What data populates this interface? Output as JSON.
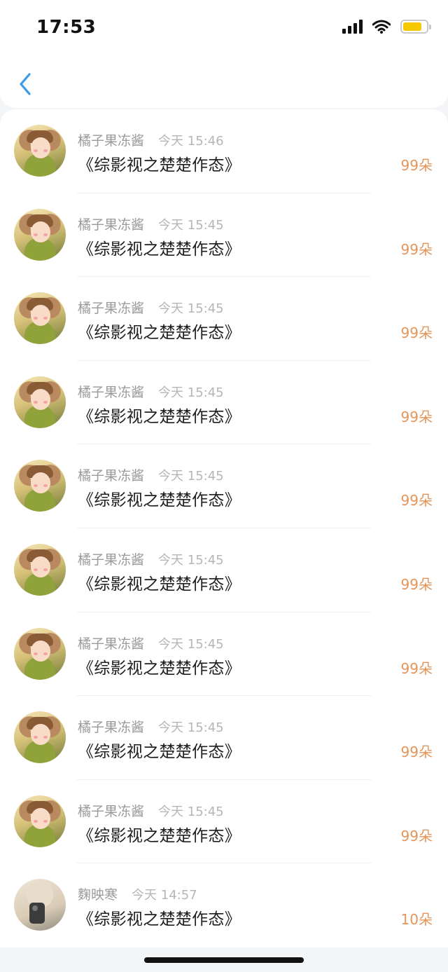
{
  "status_bar": {
    "time": "17:53",
    "signal_icon": "cellular-signal-icon",
    "wifi_icon": "wifi-icon",
    "battery_icon": "battery-icon",
    "battery_color": "#f5c800",
    "battery_level": 0.82
  },
  "nav": {
    "back_icon": "chevron-left-icon",
    "accent_color": "#3a9be8"
  },
  "records": [
    {
      "name": "橘子果冻酱",
      "time": "今天 15:46",
      "title": "《综影视之楚楚作态》",
      "amount": "99朵",
      "avatar": "girl-avatar"
    },
    {
      "name": "橘子果冻酱",
      "time": "今天 15:45",
      "title": "《综影视之楚楚作态》",
      "amount": "99朵",
      "avatar": "girl-avatar"
    },
    {
      "name": "橘子果冻酱",
      "time": "今天 15:45",
      "title": "《综影视之楚楚作态》",
      "amount": "99朵",
      "avatar": "girl-avatar"
    },
    {
      "name": "橘子果冻酱",
      "time": "今天 15:45",
      "title": "《综影视之楚楚作态》",
      "amount": "99朵",
      "avatar": "girl-avatar"
    },
    {
      "name": "橘子果冻酱",
      "time": "今天 15:45",
      "title": "《综影视之楚楚作态》",
      "amount": "99朵",
      "avatar": "girl-avatar"
    },
    {
      "name": "橘子果冻酱",
      "time": "今天 15:45",
      "title": "《综影视之楚楚作态》",
      "amount": "99朵",
      "avatar": "girl-avatar"
    },
    {
      "name": "橘子果冻酱",
      "time": "今天 15:45",
      "title": "《综影视之楚楚作态》",
      "amount": "99朵",
      "avatar": "girl-avatar"
    },
    {
      "name": "橘子果冻酱",
      "time": "今天 15:45",
      "title": "《综影视之楚楚作态》",
      "amount": "99朵",
      "avatar": "girl-avatar"
    },
    {
      "name": "橘子果冻酱",
      "time": "今天 15:45",
      "title": "《综影视之楚楚作态》",
      "amount": "99朵",
      "avatar": "girl-avatar"
    },
    {
      "name": "麴映寒",
      "time": "今天 14:57",
      "title": "《综影视之楚楚作态》",
      "amount": "10朵",
      "avatar": "phone-photo-avatar"
    }
  ],
  "colors": {
    "amount": "#e4955a",
    "name": "#9a9a9a",
    "time": "#b6b6b6",
    "title": "#1f1f1f"
  }
}
